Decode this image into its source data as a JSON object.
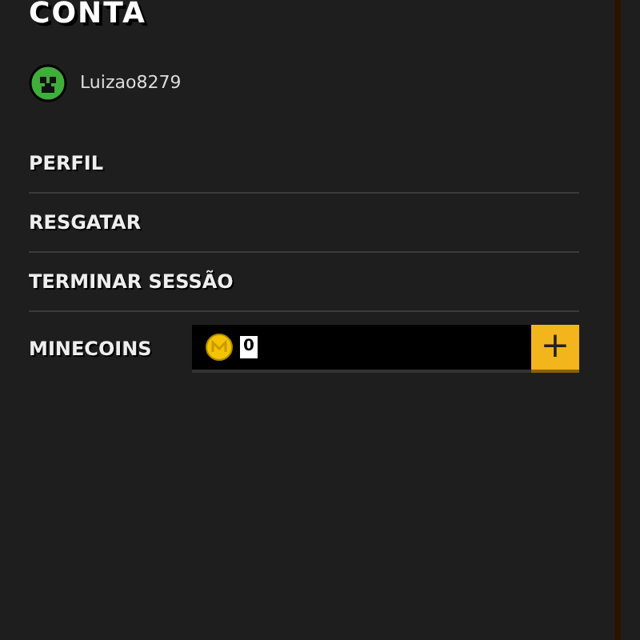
{
  "title": "CONTA",
  "user": {
    "name": "Luizao8279"
  },
  "menu": [
    {
      "label": "PERFIL"
    },
    {
      "label": "RESGATAR"
    },
    {
      "label": "TERMINAR SESSÃO"
    }
  ],
  "minecoins": {
    "label": "MINECOINS",
    "value": "0",
    "add_button": "+"
  }
}
